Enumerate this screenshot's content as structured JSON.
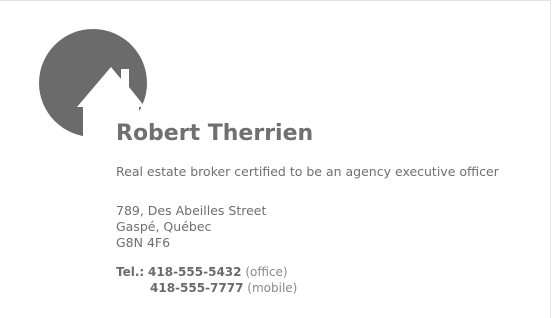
{
  "contact": {
    "name": "Robert Therrien",
    "title": "Real estate broker certified to be an agency executive officer",
    "address": {
      "line1": "789, Des Abeilles Street",
      "line2": "Gaspé, Québec",
      "line3": "G8N 4F6"
    },
    "phones": {
      "label": "Tel.:",
      "office_number": "418-555-5432",
      "office_type": "(office)",
      "mobile_number": "418-555-7777",
      "mobile_type": "(mobile)"
    }
  },
  "logo": {
    "icon": "house-in-circle-icon",
    "color": "#6b6b6b"
  }
}
